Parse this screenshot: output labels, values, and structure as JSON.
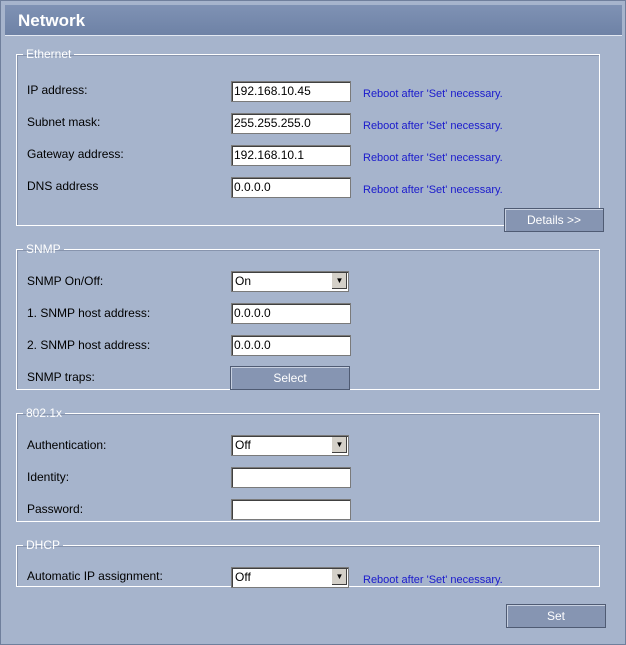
{
  "window": {
    "title": "Network"
  },
  "ethernet": {
    "legend": "Ethernet",
    "ip_label": "IP address:",
    "ip_value": "192.168.10.45",
    "subnet_label": "Subnet mask:",
    "subnet_value": "255.255.255.0",
    "gateway_label": "Gateway address:",
    "gateway_value": "192.168.10.1",
    "dns_label": "DNS address",
    "dns_value": "0.0.0.0",
    "reboot_note": "Reboot after 'Set' necessary.",
    "details_button": "Details >>"
  },
  "snmp": {
    "legend": "SNMP",
    "onoff_label": "SNMP On/Off:",
    "onoff_value": "On",
    "host1_label": "1. SNMP host address:",
    "host1_value": "0.0.0.0",
    "host2_label": "2. SNMP host address:",
    "host2_value": "0.0.0.0",
    "traps_label": "SNMP traps:",
    "traps_button": "Select"
  },
  "dot1x": {
    "legend": "802.1x",
    "auth_label": "Authentication:",
    "auth_value": "Off",
    "identity_label": "Identity:",
    "identity_value": "",
    "password_label": "Password:",
    "password_value": ""
  },
  "dhcp": {
    "legend": "DHCP",
    "auto_label": "Automatic IP assignment:",
    "auto_value": "Off",
    "reboot_note": "Reboot after 'Set' necessary."
  },
  "footer": {
    "set_button": "Set"
  },
  "icons": {
    "dropdown": "chevron-down-icon"
  }
}
